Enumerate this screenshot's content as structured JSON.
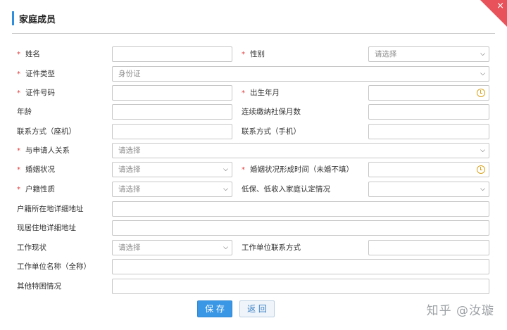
{
  "dialog": {
    "title": "家庭成员",
    "close_glyph": "×"
  },
  "placeholders": {
    "select": "请选择",
    "id_type_value": "身份证"
  },
  "icons": {
    "chevron": "chevron-down-icon",
    "clock": "clock-icon"
  },
  "labels": {
    "name": "姓名",
    "gender": "性别",
    "id_type": "证件类型",
    "id_number": "证件号码",
    "birth": "出生年月",
    "age": "年龄",
    "insurance_months": "连续缴纳社保月数",
    "phone_landline": "联系方式（座机）",
    "phone_mobile": "联系方式（手机）",
    "relation": "与申请人关系",
    "marital": "婚姻状况",
    "marital_time": "婚姻状况形成时间（未婚不填）",
    "hukou_type": "户籍性质",
    "low_income": "低保、低收入家庭认定情况",
    "hukou_address": "户籍所在地详细地址",
    "current_address": "现居住地详细地址",
    "work_status": "工作现状",
    "work_contact": "工作单位联系方式",
    "work_name": "工作单位名称（全称）",
    "special": "其他特困情况"
  },
  "required_mark": "*",
  "buttons": {
    "save": "保 存",
    "back": "返 回"
  },
  "watermark": "知乎 @汝璇",
  "colors": {
    "accent": "#2f8fdb",
    "close": "#e8525a",
    "required": "#e03c3c",
    "save_bg": "#3a97e6"
  }
}
